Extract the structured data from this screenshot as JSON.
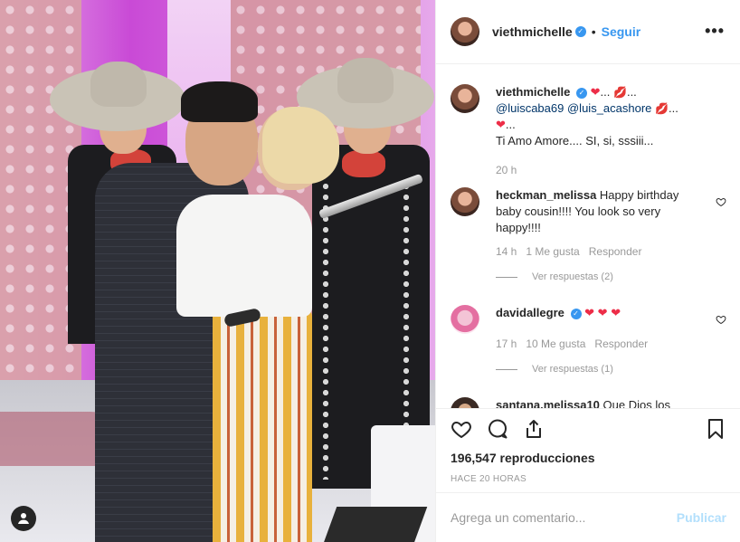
{
  "post": {
    "username": "viethmichelle",
    "follow_label": "Seguir",
    "separator": "•"
  },
  "caption": {
    "username": "viethmichelle",
    "dots1": "...",
    "mention1": "@luiscaba69",
    "mention2": "@luis_acashore",
    "dots3": "...",
    "text": "Ti Amo Amore.... SI, si, sssiii...",
    "time": "20 h"
  },
  "comments": [
    {
      "username": "heckman_melissa",
      "text": "Happy birthday baby cousin!!!! You look so very happy!!!!",
      "time": "14 h",
      "likes": "1 Me gusta",
      "reply": "Responder",
      "view_replies": "Ver respuestas (2)"
    },
    {
      "username": "davidallegre",
      "text": "",
      "time": "17 h",
      "likes": "10 Me gusta",
      "reply": "Responder",
      "view_replies": "Ver respuestas (1)"
    },
    {
      "username": "santana.melissa10",
      "text": "Que Dios los mantenga unidos por siempre"
    }
  ],
  "stats": {
    "views": "196,547",
    "views_label": "reproducciones",
    "time_ago": "HACE 20 HORAS"
  },
  "add_comment": {
    "placeholder": "Agrega un comentario...",
    "publish": "Publicar"
  },
  "icons": {
    "heart": "heart-icon",
    "comment": "comment-icon",
    "share": "share-icon",
    "bookmark": "bookmark-icon",
    "more": "more-icon",
    "user": "user-icon"
  },
  "colors": {
    "accent": "#3897f0",
    "publish_disabled": "#b2dffc",
    "heart": "#ed2d48"
  }
}
